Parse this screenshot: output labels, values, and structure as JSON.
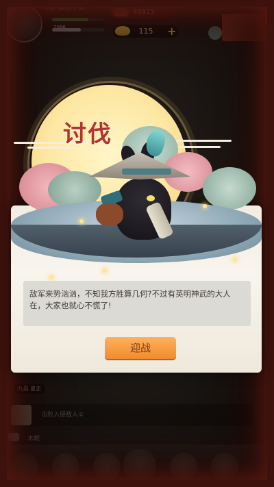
{
  "top_hud": {
    "level_text": "3级 蜡烛中普",
    "power_value": "49815",
    "coins": "115",
    "hp_text": "2086",
    "hp_fill_percent": 70,
    "xp_fill_percent": 55
  },
  "dialog": {
    "title": "讨伐",
    "message": "敌军来势汹汹，不知我方胜算几何?不过有英明神武的大人在，大家也就心不慌了!",
    "accept_button": "迎战"
  },
  "background": {
    "hero_name": "九昌 夏正",
    "task_text": "击败入侵敌人②",
    "chat_label": "木眠"
  },
  "colors": {
    "title": "#b3342a",
    "button": "#f08c2d",
    "frame": "#7a2418"
  }
}
